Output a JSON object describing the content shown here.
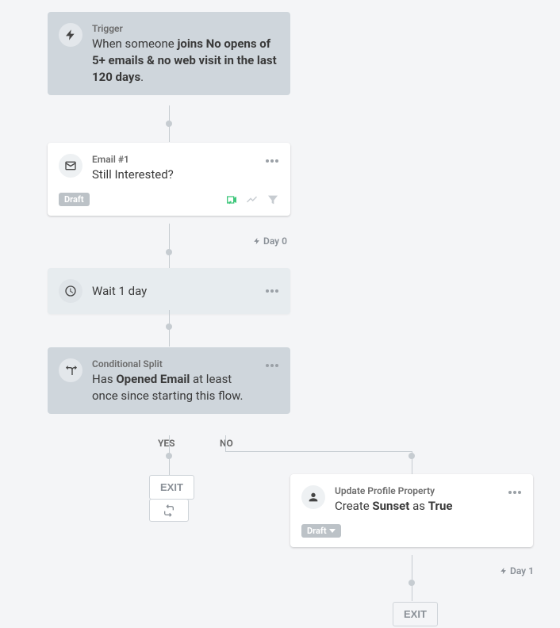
{
  "nodes": {
    "trigger": {
      "type_label": "Trigger",
      "desc_prefix": "When someone ",
      "desc_bold": "joins No opens of 5+ emails & no web visit in the last 120 days",
      "desc_suffix": "."
    },
    "email1": {
      "type_label": "Email #1",
      "subject": "Still Interested?",
      "status": "Draft",
      "day_label": "Day 0"
    },
    "wait": {
      "text": "Wait 1 day"
    },
    "split": {
      "type_label": "Conditional Split",
      "desc_prefix": "Has ",
      "desc_bold": "Opened Email",
      "desc_suffix": " at least once since starting this flow."
    },
    "branch_yes": "YES",
    "branch_no": "NO",
    "exit_label": "EXIT",
    "update": {
      "type_label": "Update Profile Property",
      "desc_prefix": "Create ",
      "desc_bold1": "Sunset",
      "desc_mid": " as ",
      "desc_bold2": "True",
      "status": "Draft",
      "day_label": "Day 1"
    }
  }
}
